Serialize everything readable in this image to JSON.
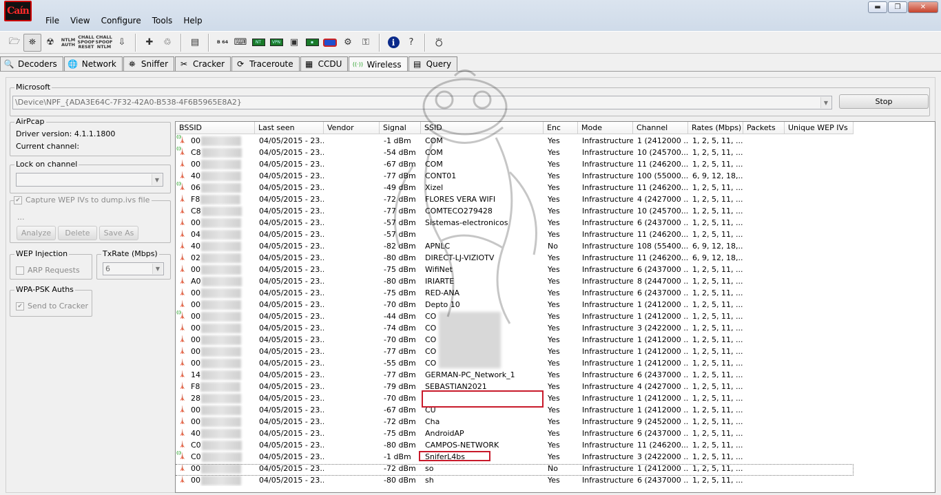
{
  "app": {
    "logo_text": "Caín"
  },
  "menu": [
    "File",
    "View",
    "Configure",
    "Tools",
    "Help"
  ],
  "window_controls": {
    "minimize": "▬",
    "maximize": "❐",
    "close": "✕"
  },
  "toolbar": [
    {
      "icon": "open-folder-icon",
      "glyph": "🗁"
    },
    {
      "icon": "start-sniffer-icon",
      "glyph": "⛯",
      "active": true
    },
    {
      "icon": "radiation-icon",
      "glyph": "☢"
    },
    {
      "icon": "ntlm-auth-icon",
      "text": "NTLM AUTH"
    },
    {
      "icon": "challenge-spoof-reset-icon",
      "text": "CHALL SPOOF RESET"
    },
    {
      "icon": "challenge-spoof-ntlm-icon",
      "text": "CHALL SPOOF NTLM"
    },
    {
      "icon": "network-download-icon",
      "glyph": "⇩"
    },
    {
      "sep": true
    },
    {
      "icon": "add-icon",
      "glyph": "✚"
    },
    {
      "icon": "remove-icon",
      "glyph": "♲"
    },
    {
      "sep": true
    },
    {
      "icon": "certificate-icon",
      "glyph": "▤"
    },
    {
      "sep": true
    },
    {
      "icon": "base64-icon",
      "text": "B 64"
    },
    {
      "icon": "hash-calculator-icon",
      "glyph": "⌨"
    },
    {
      "icon": "monitor-icon-1",
      "mon": "NT"
    },
    {
      "icon": "monitor-icon-2",
      "mon": "VPN"
    },
    {
      "icon": "rdp-icon",
      "glyph": "▣"
    },
    {
      "icon": "monitor-icon-3",
      "mon": "▪"
    },
    {
      "icon": "routing-icon",
      "pill": true
    },
    {
      "icon": "network-ip-icon",
      "glyph": "⚙"
    },
    {
      "icon": "password-key-icon",
      "glyph": "⚿"
    },
    {
      "sep": true
    },
    {
      "icon": "about-icon",
      "blue": "i"
    },
    {
      "icon": "help-icon",
      "glyph": "?"
    },
    {
      "sep": true
    },
    {
      "icon": "exit-icon",
      "glyph": "⛣"
    }
  ],
  "tabs": [
    {
      "label": "Decoders",
      "icon": "decoders-icon",
      "glyph": "🔍"
    },
    {
      "label": "Network",
      "icon": "network-icon",
      "glyph": "🌐"
    },
    {
      "label": "Sniffer",
      "icon": "sniffer-icon",
      "glyph": "⛯"
    },
    {
      "label": "Cracker",
      "icon": "cracker-icon",
      "glyph": "✂"
    },
    {
      "label": "Traceroute",
      "icon": "traceroute-icon",
      "glyph": "⟳"
    },
    {
      "label": "CCDU",
      "icon": "ccdu-icon",
      "glyph": "▦"
    },
    {
      "label": "Wireless",
      "icon": "wireless-icon",
      "glyph": "((·))",
      "active": true
    },
    {
      "label": "Query",
      "icon": "query-icon",
      "glyph": "▤"
    }
  ],
  "adapter": {
    "group_label": "Microsoft",
    "device": "\\Device\\NPF_{ADA3E64C-7F32-42A0-B538-4F6B5965E8A2}",
    "stop_label": "Stop"
  },
  "airpcap": {
    "group_label": "AirPcap",
    "driver_version": "Driver version: 4.1.1.1800",
    "current_channel": "Current channel:"
  },
  "lock_channel": {
    "group_label": "Lock on channel",
    "value": ""
  },
  "capture": {
    "label": "Capture WEP IVs to dump.ivs file",
    "placeholder": "...",
    "analyze": "Analyze",
    "delete": "Delete",
    "save_as": "Save As"
  },
  "wep_injection": {
    "group_label": "WEP Injection",
    "arp_requests": "ARP Requests"
  },
  "txrate": {
    "group_label": "TxRate (Mbps)",
    "value": "6"
  },
  "wpa_psk": {
    "group_label": "WPA-PSK Auths",
    "send_to_cracker": "Send to Cracker"
  },
  "table": {
    "columns": [
      "BSSID",
      "Last seen",
      "Vendor",
      "Signal",
      "SSID",
      "Enc",
      "Mode",
      "Channel",
      "Rates (Mbps)",
      "Packets",
      "Unique WEP IVs"
    ],
    "rows": [
      {
        "bssid": "00",
        "last_seen": "04/05/2015 - 23...",
        "vendor": "",
        "signal": "-1 dBm",
        "ssid": "COM",
        "enc": "Yes",
        "mode": "Infrastructure",
        "channel": "1 (2412000 ...",
        "rates": "1, 2, 5, 11, ...",
        "active": true
      },
      {
        "bssid": "C8",
        "last_seen": "04/05/2015 - 23...",
        "vendor": "",
        "signal": "-54 dBm",
        "ssid": "COM",
        "enc": "Yes",
        "mode": "Infrastructure",
        "channel": "10 (245700...",
        "rates": "1, 2, 5, 11, ...",
        "active": true
      },
      {
        "bssid": "00",
        "last_seen": "04/05/2015 - 23...",
        "vendor": "",
        "signal": "-67 dBm",
        "ssid": "COM",
        "enc": "Yes",
        "mode": "Infrastructure",
        "channel": "11 (246200...",
        "rates": "1, 2, 5, 11, ...",
        "active": false
      },
      {
        "bssid": "40",
        "last_seen": "04/05/2015 - 23...",
        "vendor": "",
        "signal": "-77 dBm",
        "ssid": "CONT01",
        "enc": "Yes",
        "mode": "Infrastructure",
        "channel": "100 (55000...",
        "rates": "6, 9, 12, 18,...",
        "active": false
      },
      {
        "bssid": "06",
        "last_seen": "04/05/2015 - 23...",
        "vendor": "",
        "signal": "-49 dBm",
        "ssid": "Xizel",
        "enc": "Yes",
        "mode": "Infrastructure",
        "channel": "11 (246200...",
        "rates": "1, 2, 5, 11, ...",
        "active": true
      },
      {
        "bssid": "F8",
        "last_seen": "04/05/2015 - 23...",
        "vendor": "",
        "signal": "-72 dBm",
        "ssid": "FLORES VERA WIFI",
        "enc": "Yes",
        "mode": "Infrastructure",
        "channel": "4 (2427000 ...",
        "rates": "1, 2, 5, 11, ...",
        "active": false
      },
      {
        "bssid": "C8",
        "last_seen": "04/05/2015 - 23...",
        "vendor": "",
        "signal": "-77 dBm",
        "ssid": "COMTECO279428",
        "enc": "Yes",
        "mode": "Infrastructure",
        "channel": "10 (245700...",
        "rates": "1, 2, 5, 11, ...",
        "active": false
      },
      {
        "bssid": "00",
        "last_seen": "04/05/2015 - 23...",
        "vendor": "",
        "signal": "-57 dBm",
        "ssid": "Sistemas-electronicos",
        "enc": "Yes",
        "mode": "Infrastructure",
        "channel": "6 (2437000 ...",
        "rates": "1, 2, 5, 11, ...",
        "active": false
      },
      {
        "bssid": "04",
        "last_seen": "04/05/2015 - 23...",
        "vendor": "",
        "signal": "-57 dBm",
        "ssid": "",
        "enc": "Yes",
        "mode": "Infrastructure",
        "channel": "11 (246200...",
        "rates": "1, 2, 5, 11, ...",
        "active": false
      },
      {
        "bssid": "40",
        "last_seen": "04/05/2015 - 23...",
        "vendor": "",
        "signal": "-82 dBm",
        "ssid": "APNLC",
        "enc": "No",
        "mode": "Infrastructure",
        "channel": "108 (55400...",
        "rates": "6, 9, 12, 18,...",
        "active": false
      },
      {
        "bssid": "02",
        "last_seen": "04/05/2015 - 23...",
        "vendor": "",
        "signal": "-80 dBm",
        "ssid": "DIRECT-LJ-VIZIOTV",
        "enc": "Yes",
        "mode": "Infrastructure",
        "channel": "11 (246200...",
        "rates": "6, 9, 12, 18,...",
        "active": false
      },
      {
        "bssid": "00",
        "last_seen": "04/05/2015 - 23...",
        "vendor": "",
        "signal": "-75 dBm",
        "ssid": "WifiNet",
        "enc": "Yes",
        "mode": "Infrastructure",
        "channel": "6 (2437000 ...",
        "rates": "1, 2, 5, 11, ...",
        "active": false
      },
      {
        "bssid": "A0",
        "last_seen": "04/05/2015 - 23...",
        "vendor": "",
        "signal": "-80 dBm",
        "ssid": "IRIARTE",
        "enc": "Yes",
        "mode": "Infrastructure",
        "channel": "8 (2447000 ...",
        "rates": "1, 2, 5, 11, ...",
        "active": false
      },
      {
        "bssid": "00",
        "last_seen": "04/05/2015 - 23...",
        "vendor": "",
        "signal": "-75 dBm",
        "ssid": "RED-ANA",
        "enc": "Yes",
        "mode": "Infrastructure",
        "channel": "6 (2437000 ...",
        "rates": "1, 2, 5, 11, ...",
        "active": false
      },
      {
        "bssid": "00",
        "last_seen": "04/05/2015 - 23...",
        "vendor": "",
        "signal": "-70 dBm",
        "ssid": "Depto 10",
        "enc": "Yes",
        "mode": "Infrastructure",
        "channel": "1 (2412000 ...",
        "rates": "1, 2, 5, 11, ...",
        "active": false
      },
      {
        "bssid": "00",
        "last_seen": "04/05/2015 - 23...",
        "vendor": "",
        "signal": "-44 dBm",
        "ssid": "CO",
        "enc": "Yes",
        "mode": "Infrastructure",
        "channel": "1 (2412000 ...",
        "rates": "1, 2, 5, 11, ...",
        "active": true
      },
      {
        "bssid": "00",
        "last_seen": "04/05/2015 - 23...",
        "vendor": "",
        "signal": "-74 dBm",
        "ssid": "CO",
        "enc": "Yes",
        "mode": "Infrastructure",
        "channel": "3 (2422000 ...",
        "rates": "1, 2, 5, 11, ...",
        "active": false
      },
      {
        "bssid": "00",
        "last_seen": "04/05/2015 - 23...",
        "vendor": "",
        "signal": "-70 dBm",
        "ssid": "CO",
        "enc": "Yes",
        "mode": "Infrastructure",
        "channel": "1 (2412000 ...",
        "rates": "1, 2, 5, 11, ...",
        "active": false
      },
      {
        "bssid": "00",
        "last_seen": "04/05/2015 - 23...",
        "vendor": "",
        "signal": "-77 dBm",
        "ssid": "CO",
        "enc": "Yes",
        "mode": "Infrastructure",
        "channel": "1 (2412000 ...",
        "rates": "1, 2, 5, 11, ...",
        "active": false
      },
      {
        "bssid": "00",
        "last_seen": "04/05/2015 - 23...",
        "vendor": "",
        "signal": "-55 dBm",
        "ssid": "CO",
        "enc": "Yes",
        "mode": "Infrastructure",
        "channel": "1 (2412000 ...",
        "rates": "1, 2, 5, 11, ...",
        "active": false
      },
      {
        "bssid": "14",
        "last_seen": "04/05/2015 - 23...",
        "vendor": "",
        "signal": "-77 dBm",
        "ssid": "GERMAN-PC_Network_1",
        "enc": "Yes",
        "mode": "Infrastructure",
        "channel": "6 (2437000 ...",
        "rates": "1, 2, 5, 11, ...",
        "active": false
      },
      {
        "bssid": "F8",
        "last_seen": "04/05/2015 - 23...",
        "vendor": "",
        "signal": "-79 dBm",
        "ssid": "SEBASTIAN2021",
        "enc": "Yes",
        "mode": "Infrastructure",
        "channel": "4 (2427000 ...",
        "rates": "1, 2, 5, 11, ...",
        "active": false
      },
      {
        "bssid": "28",
        "last_seen": "04/05/2015 - 23...",
        "vendor": "",
        "signal": "-70 dBm",
        "ssid": "",
        "enc": "Yes",
        "mode": "Infrastructure",
        "channel": "1 (2412000 ...",
        "rates": "1, 2, 5, 11, ...",
        "active": false
      },
      {
        "bssid": "00",
        "last_seen": "04/05/2015 - 23...",
        "vendor": "",
        "signal": "-67 dBm",
        "ssid": "CU",
        "enc": "Yes",
        "mode": "Infrastructure",
        "channel": "1 (2412000 ...",
        "rates": "1, 2, 5, 11, ...",
        "active": false
      },
      {
        "bssid": "00",
        "last_seen": "04/05/2015 - 23...",
        "vendor": "",
        "signal": "-72 dBm",
        "ssid": "Cha",
        "enc": "Yes",
        "mode": "Infrastructure",
        "channel": "9 (2452000 ...",
        "rates": "1, 2, 5, 11, ...",
        "active": false
      },
      {
        "bssid": "40",
        "last_seen": "04/05/2015 - 23...",
        "vendor": "",
        "signal": "-75 dBm",
        "ssid": "AndroidAP",
        "enc": "Yes",
        "mode": "Infrastructure",
        "channel": "6 (2437000 ...",
        "rates": "1, 2, 5, 11, ...",
        "active": false
      },
      {
        "bssid": "C0",
        "last_seen": "04/05/2015 - 23...",
        "vendor": "",
        "signal": "-80 dBm",
        "ssid": "CAMPOS-NETWORK",
        "enc": "Yes",
        "mode": "Infrastructure",
        "channel": "11 (246200...",
        "rates": "1, 2, 5, 11, ...",
        "active": false
      },
      {
        "bssid": "C0",
        "last_seen": "04/05/2015 - 23...",
        "vendor": "",
        "signal": "-1 dBm",
        "ssid": "SniferL4bs",
        "enc": "Yes",
        "mode": "Infrastructure",
        "channel": "3 (2422000 ...",
        "rates": "1, 2, 5, 11, ...",
        "active": true
      },
      {
        "bssid": "00",
        "last_seen": "04/05/2015 - 23...",
        "vendor": "",
        "signal": "-72 dBm",
        "ssid": "so",
        "enc": "No",
        "mode": "Infrastructure",
        "channel": "1 (2412000 ...",
        "rates": "1, 2, 5, 11, ...",
        "active": false
      },
      {
        "bssid": "00",
        "last_seen": "04/05/2015 - 23...",
        "vendor": "",
        "signal": "-80 dBm",
        "ssid": "sh",
        "enc": "Yes",
        "mode": "Infrastructure",
        "channel": "6 (2437000 ...",
        "rates": "1, 2, 5, 11, ...",
        "active": false
      }
    ]
  },
  "colors": {
    "highlight_box": "#c8192a",
    "title_bar": "#dbe4ef",
    "logo_red": "#ff2a2a"
  }
}
